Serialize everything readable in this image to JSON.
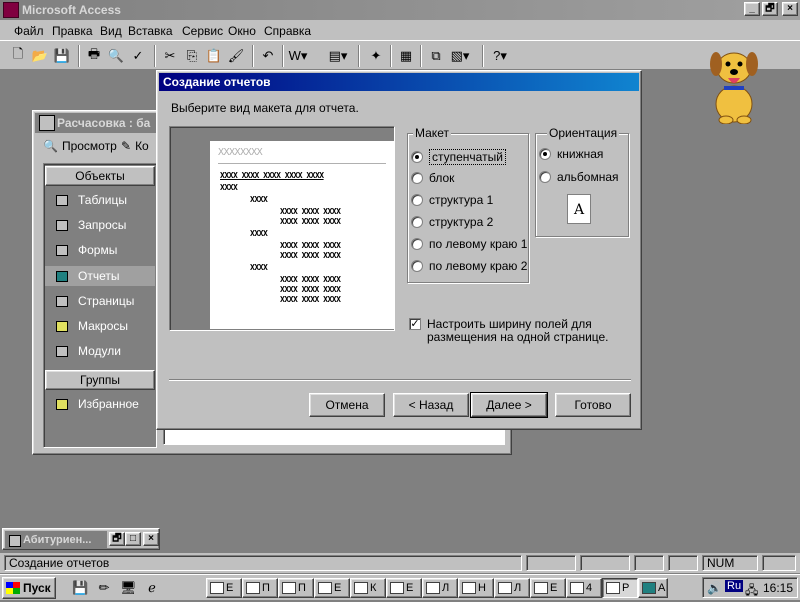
{
  "app": {
    "title": "Microsoft Access",
    "min_label": "_",
    "restore_label": "🗗",
    "close_label": "×"
  },
  "menu": [
    {
      "label": "Файл"
    },
    {
      "label": "Правка"
    },
    {
      "label": "Вид"
    },
    {
      "label": "Вставка"
    },
    {
      "label": "Сервис"
    },
    {
      "label": "Окно"
    },
    {
      "label": "Справка"
    }
  ],
  "toolbar": {
    "icons": [
      "new-icon",
      "open-icon",
      "save-icon",
      "print-icon",
      "print-preview-icon",
      "spelling-icon",
      "cut-icon",
      "copy-icon",
      "paste-icon",
      "format-painter-icon",
      "undo-icon",
      "office-links-icon",
      "analyze-icon",
      "code-icon",
      "properties-icon",
      "relationships-icon",
      "new-object-icon",
      "help-icon"
    ]
  },
  "dbwindow": {
    "title": "Расчасовка : ба",
    "preview_label": "Просмотр",
    "design_label": "Ко",
    "objects_header": "Объекты",
    "groups_header": "Группы",
    "objects": [
      {
        "label": "Таблицы",
        "icon": "table-icon"
      },
      {
        "label": "Запросы",
        "icon": "query-icon"
      },
      {
        "label": "Формы",
        "icon": "form-icon"
      },
      {
        "label": "Отчеты",
        "icon": "report-icon"
      },
      {
        "label": "Страницы",
        "icon": "page-icon"
      },
      {
        "label": "Макросы",
        "icon": "macro-icon"
      },
      {
        "label": "Модули",
        "icon": "module-icon"
      }
    ],
    "favorites_label": "Избранное"
  },
  "wizard": {
    "title": "Создание отчетов",
    "prompt": "Выберите вид макета для отчета.",
    "preview": {
      "header": "XXXXXXXX",
      "columns": "XXXX  XXXX  XXXX  XXXX  XXXX",
      "group1": "XXXX",
      "group2": "XXXX",
      "row": "XXXX  XXXX  XXXX"
    },
    "layout_group_label": "Макет",
    "layouts": [
      {
        "label": "ступенчатый",
        "selected": true
      },
      {
        "label": "блок",
        "selected": false
      },
      {
        "label": "структура 1",
        "selected": false
      },
      {
        "label": "структура 2",
        "selected": false
      },
      {
        "label": "по левому краю 1",
        "selected": false
      },
      {
        "label": "по левому краю 2",
        "selected": false
      }
    ],
    "orientation_group_label": "Ориентация",
    "orientations": [
      {
        "label": "книжная",
        "selected": true
      },
      {
        "label": "альбомная",
        "selected": false
      }
    ],
    "orientation_preview_letter": "A",
    "fit_checkbox_line1": "Настроить ширину полей для",
    "fit_checkbox_line2": "размещения на одной странице.",
    "fit_checked": true,
    "buttons": {
      "cancel": "Отмена",
      "back": "< Назад",
      "next": "Далее >",
      "finish": "Готово"
    }
  },
  "minimized_window": {
    "title": "Абитуриен..."
  },
  "status": {
    "text": "Создание отчетов",
    "num": "NUM"
  },
  "taskbar": {
    "start_label": "Пуск",
    "tasks": [
      {
        "label": "Е"
      },
      {
        "label": "П"
      },
      {
        "label": "П"
      },
      {
        "label": "Е"
      },
      {
        "label": "К"
      },
      {
        "label": "Е"
      },
      {
        "label": "Л"
      },
      {
        "label": "Н"
      },
      {
        "label": "Л"
      },
      {
        "label": "Е"
      },
      {
        "label": "4"
      },
      {
        "label": "Р"
      },
      {
        "label": "А"
      }
    ],
    "lang": "Ru",
    "clock": "16:15"
  }
}
